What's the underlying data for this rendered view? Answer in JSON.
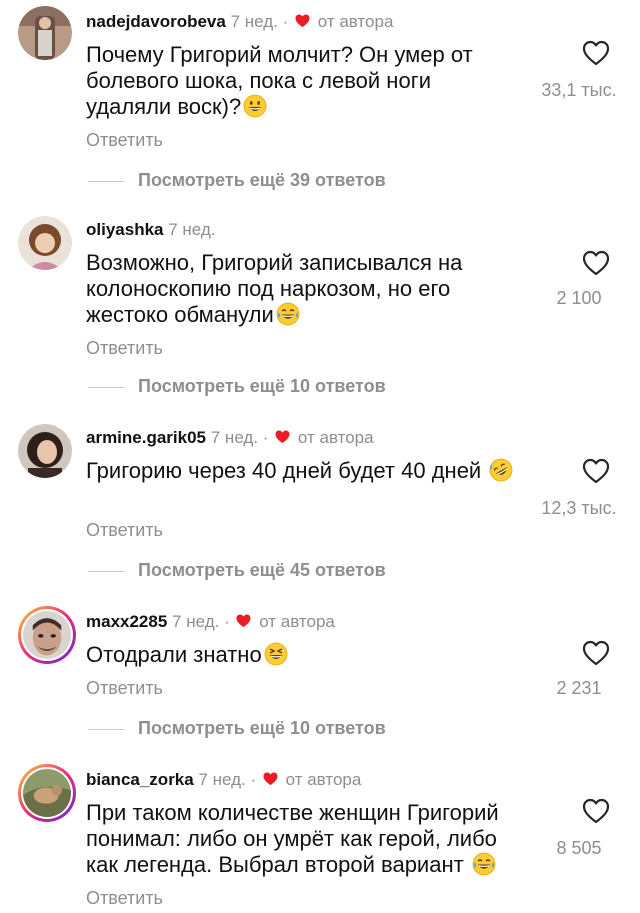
{
  "comments": [
    {
      "username": "nadejdavorobeva",
      "time": "7 нед.",
      "separator": "·",
      "author_badge": "от автора",
      "text": "Почему Григорий молчит? Он умер от болевого шока, пока с левой ноги удаляли воск)?",
      "emoji": "grinning-face-emoji",
      "reply": "Ответить",
      "likes": "33,1 тыс.",
      "more_replies": "Посмотреть ещё 39 ответов"
    },
    {
      "username": "oliyashka",
      "time": "7 нед.",
      "text": "Возможно, Григорий записывался на колоноскопию под наркозом, но его жестоко обманули",
      "emoji": "tears-of-joy-emoji",
      "reply": "Ответить",
      "likes": "2 100",
      "more_replies": "Посмотреть ещё 10 ответов"
    },
    {
      "username": "armine.garik05",
      "time": "7 нед.",
      "separator": "·",
      "author_badge": "от автора",
      "text": "Григорию через 40 дней будет 40 дней",
      "emoji": "rolling-laughing-emoji",
      "reply": "Ответить",
      "likes": "12,3 тыс.",
      "more_replies": "Посмотреть ещё 45 ответов"
    },
    {
      "username": "maxx2285",
      "time": "7 нед.",
      "separator": "·",
      "author_badge": "от автора",
      "text": "Отодрали знатно",
      "emoji": "squinting-laughing-emoji",
      "reply": "Ответить",
      "likes": "2 231",
      "more_replies": "Посмотреть ещё 10 ответов"
    },
    {
      "username": "bianca_zorka",
      "time": "7 нед.",
      "separator": "·",
      "author_badge": "от автора",
      "text": "При таком количестве женщин Григорий понимал: либо он умрёт как герой, либо как легенда. Выбрал второй вариант",
      "emoji": "tears-of-joy-emoji",
      "reply": "Ответить",
      "likes": "8 505"
    }
  ],
  "colors": {
    "secondary": "#8e8e8e",
    "author_heart": "#ed1c24",
    "text": "#111111"
  }
}
